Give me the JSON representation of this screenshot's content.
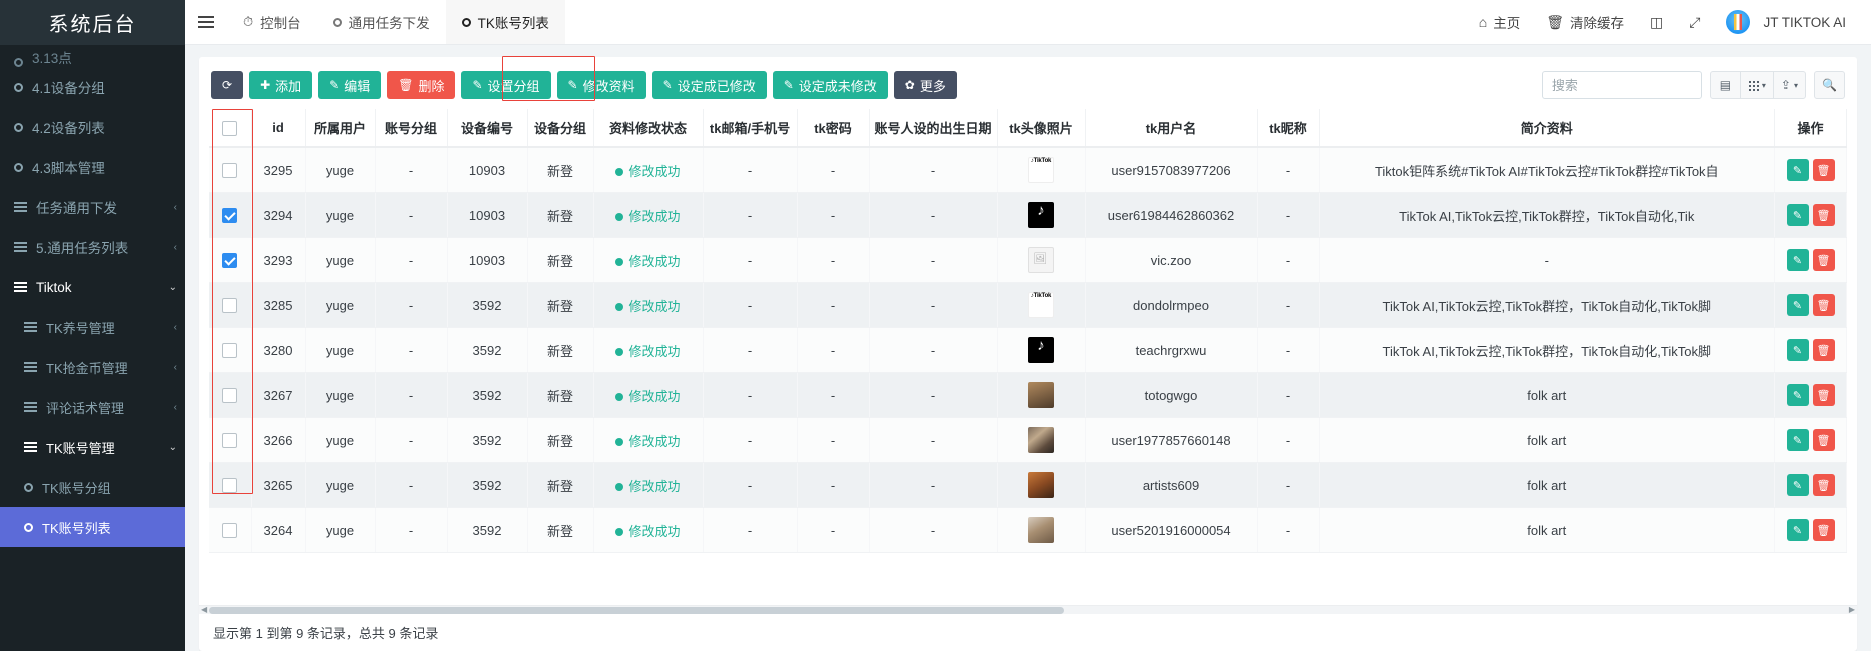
{
  "sidebar": {
    "brand": "系统后台",
    "items": [
      {
        "label": "3.13点",
        "icon": "circle-icon",
        "level": 0,
        "state": "partial"
      },
      {
        "label": "4.1设备分组",
        "icon": "circle-icon",
        "level": 0,
        "state": "normal"
      },
      {
        "label": "4.2设备列表",
        "icon": "circle-icon",
        "level": 0,
        "state": "normal"
      },
      {
        "label": "4.3脚本管理",
        "icon": "circle-icon",
        "level": 0,
        "state": "normal"
      },
      {
        "label": "任务通用下发",
        "icon": "list-icon",
        "level": 0,
        "state": "normal",
        "caret": "‹"
      },
      {
        "label": "5.通用任务列表",
        "icon": "list-icon",
        "level": 0,
        "state": "normal",
        "caret": "‹"
      },
      {
        "label": "Tiktok",
        "icon": "list-icon",
        "level": 0,
        "state": "open",
        "caret": "⌄"
      },
      {
        "label": "TK养号管理",
        "icon": "list-icon",
        "level": 1,
        "state": "normal",
        "caret": "‹"
      },
      {
        "label": "TK抢金币管理",
        "icon": "list-icon",
        "level": 1,
        "state": "normal",
        "caret": "‹"
      },
      {
        "label": "评论话术管理",
        "icon": "list-icon",
        "level": 1,
        "state": "normal",
        "caret": "‹"
      },
      {
        "label": "TK账号管理",
        "icon": "list-icon",
        "level": 1,
        "state": "open",
        "caret": "⌄"
      },
      {
        "label": "TK账号分组",
        "icon": "circle-icon",
        "level": 2,
        "state": "normal"
      },
      {
        "label": "TK账号列表",
        "icon": "circle-icon",
        "level": 2,
        "state": "active"
      }
    ]
  },
  "topbar": {
    "menu_icon": "hamburger-icon",
    "tabs": [
      {
        "label": "控制台",
        "icon": "dashboard-icon",
        "active": false
      },
      {
        "label": "通用任务下发",
        "icon": "circle-icon",
        "active": false
      },
      {
        "label": "TK账号列表",
        "icon": "circle-icon",
        "active": true
      }
    ],
    "right_items": [
      {
        "label": "主页",
        "icon": "home-icon"
      },
      {
        "label": "清除缓存",
        "icon": "trash-icon"
      },
      {
        "label": "",
        "icon": "theme-icon"
      },
      {
        "label": "",
        "icon": "fullscreen-icon"
      }
    ],
    "user": {
      "name": "JT TIKTOK AI",
      "avatar": "avatar-icon"
    }
  },
  "toolbar": {
    "refresh_label": "⟳",
    "buttons": [
      {
        "label": "添加",
        "icon": "plus-icon",
        "style": "green"
      },
      {
        "label": "编辑",
        "icon": "pencil-icon",
        "style": "green"
      },
      {
        "label": "删除",
        "icon": "trash-icon",
        "style": "red"
      },
      {
        "label": "设置分组",
        "icon": "pencil-icon",
        "style": "green"
      },
      {
        "label": "修改资料",
        "icon": "pencil-icon",
        "style": "green",
        "highlighted": true
      },
      {
        "label": "设定成已修改",
        "icon": "pencil-icon",
        "style": "green"
      },
      {
        "label": "设定成未修改",
        "icon": "pencil-icon",
        "style": "green"
      },
      {
        "label": "更多",
        "icon": "gear-icon",
        "style": "dark"
      }
    ],
    "search_placeholder": "搜索",
    "search_value": "",
    "icon_buttons": [
      {
        "icon": "columns-icon",
        "caret": false
      },
      {
        "icon": "grid-icon",
        "caret": true
      },
      {
        "icon": "export-icon",
        "caret": true
      }
    ],
    "search_icon_button": {
      "icon": "search-icon"
    }
  },
  "table": {
    "columns": [
      "",
      "id",
      "所属用户",
      "账号分组",
      "设备编号",
      "设备分组",
      "资料修改状态",
      "tk邮箱/手机号",
      "tk密码",
      "账号人设的出生日期",
      "tk头像照片",
      "tk用户名",
      "tk昵称",
      "简介资料",
      "操作"
    ],
    "select_all_checked": false,
    "rows": [
      {
        "checked": false,
        "id": "3295",
        "user": "yuge",
        "account_group": "-",
        "device_no": "10903",
        "device_group": "新登",
        "status": "修改成功",
        "email": "-",
        "password": "-",
        "birthday": "-",
        "avatar_type": "tiktok-logo-light",
        "username": "user9157083977206",
        "nickname": "-",
        "bio": "Tiktok钜阵系统#TikTok AI#TikTok云控#TikTok群控#TikTok自"
      },
      {
        "checked": true,
        "id": "3294",
        "user": "yuge",
        "account_group": "-",
        "device_no": "10903",
        "device_group": "新登",
        "status": "修改成功",
        "email": "-",
        "password": "-",
        "birthday": "-",
        "avatar_type": "tiktok-logo-dark",
        "username": "user61984462860362",
        "nickname": "-",
        "bio": "TikTok AI,TikTok云控,TikTok群控，TikTok自动化,Tik"
      },
      {
        "checked": true,
        "id": "3293",
        "user": "yuge",
        "account_group": "-",
        "device_no": "10903",
        "device_group": "新登",
        "status": "修改成功",
        "email": "-",
        "password": "-",
        "birthday": "-",
        "avatar_type": "broken-image",
        "username": "vic.zoo",
        "nickname": "-",
        "bio": "-"
      },
      {
        "checked": false,
        "id": "3285",
        "user": "yuge",
        "account_group": "-",
        "device_no": "3592",
        "device_group": "新登",
        "status": "修改成功",
        "email": "-",
        "password": "-",
        "birthday": "-",
        "avatar_type": "tiktok-logo-light",
        "username": "dondolrmpeo",
        "nickname": "-",
        "bio": "TikTok AI,TikTok云控,TikTok群控，TikTok自动化,TikTok脚"
      },
      {
        "checked": false,
        "id": "3280",
        "user": "yuge",
        "account_group": "-",
        "device_no": "3592",
        "device_group": "新登",
        "status": "修改成功",
        "email": "-",
        "password": "-",
        "birthday": "-",
        "avatar_type": "tiktok-logo-dark",
        "username": "teachrgrxwu",
        "nickname": "-",
        "bio": "TikTok AI,TikTok云控,TikTok群控，TikTok自动化,TikTok脚"
      },
      {
        "checked": false,
        "id": "3267",
        "user": "yuge",
        "account_group": "-",
        "device_no": "3592",
        "device_group": "新登",
        "status": "修改成功",
        "email": "-",
        "password": "-",
        "birthday": "-",
        "avatar_type": "photo-1",
        "username": "totogwgo",
        "nickname": "-",
        "bio": "folk art"
      },
      {
        "checked": false,
        "id": "3266",
        "user": "yuge",
        "account_group": "-",
        "device_no": "3592",
        "device_group": "新登",
        "status": "修改成功",
        "email": "-",
        "password": "-",
        "birthday": "-",
        "avatar_type": "photo-2",
        "username": "user1977857660148",
        "nickname": "-",
        "bio": "folk art"
      },
      {
        "checked": false,
        "id": "3265",
        "user": "yuge",
        "account_group": "-",
        "device_no": "3592",
        "device_group": "新登",
        "status": "修改成功",
        "email": "-",
        "password": "-",
        "birthday": "-",
        "avatar_type": "photo-3",
        "username": "artists609",
        "nickname": "-",
        "bio": "folk art"
      },
      {
        "checked": false,
        "id": "3264",
        "user": "yuge",
        "account_group": "-",
        "device_no": "3592",
        "device_group": "新登",
        "status": "修改成功",
        "email": "-",
        "password": "-",
        "birthday": "-",
        "avatar_type": "photo-4",
        "username": "user5201916000054",
        "nickname": "-",
        "bio": "folk art"
      }
    ],
    "row_actions": {
      "edit_icon": "pencil-icon",
      "delete_icon": "trash-icon"
    }
  },
  "footer": {
    "info": "显示第 1 到第 9 条记录，总共 9 条记录"
  },
  "colors": {
    "accent_green": "#21b397",
    "accent_red": "#f0564a",
    "dark": "#454f63",
    "sidebar_bg": "#1a2226",
    "active_menu": "#5c6bd8",
    "highlight_border": "#e8423a"
  }
}
